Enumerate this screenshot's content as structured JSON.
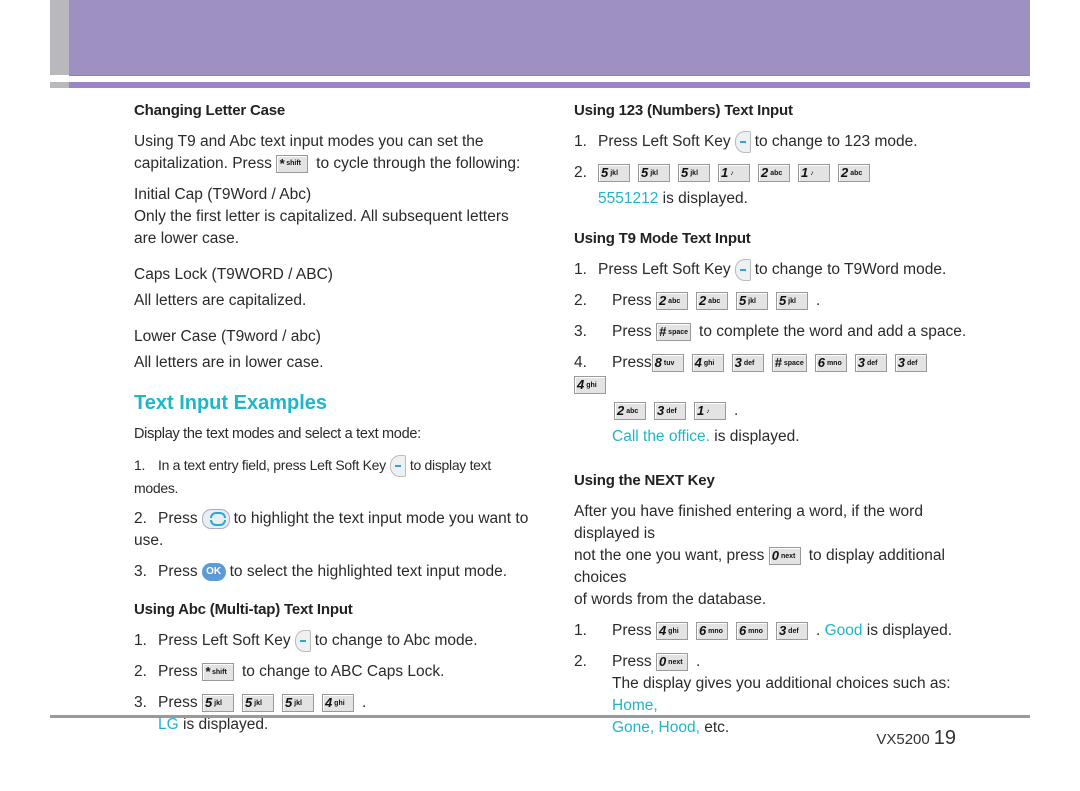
{
  "left": {
    "changing_case": {
      "heading": "Changing Letter Case",
      "intro_1": "Using T9 and Abc text input modes you can set the",
      "intro_2a": "capitalization. Press",
      "intro_2b": "to cycle through the following:",
      "modes": [
        {
          "name": "Initial Cap (T9Word / Abc)",
          "desc_1": "Only the first letter is capitalized. All subsequent letters",
          "desc_2": "are lower case."
        },
        {
          "name": "Caps Lock (T9WORD / ABC)",
          "desc_1": "All letters are capitalized."
        },
        {
          "name": "Lower Case (T9word / abc)",
          "desc_1": "All letters are in lower case."
        }
      ]
    },
    "examples": {
      "title": "Text Input Examples",
      "intro": "Display the text modes and select a text mode:",
      "steps": [
        {
          "n": "1.",
          "a": "In a text entry field, press Left Soft Key",
          "b": "to display text modes."
        },
        {
          "n": "2.",
          "a": "Press",
          "b": "to highlight the text input mode you want to use."
        },
        {
          "n": "3.",
          "a": "Press",
          "b": "to select the highlighted text input mode.",
          "ok": "OK"
        }
      ]
    },
    "abc": {
      "heading": "Using Abc (Multi-tap) Text Input",
      "s1a": "Press Left Soft Key",
      "s1b": "to change to Abc mode.",
      "s2a": "Press",
      "s2b": "to change to ABC Caps Lock.",
      "s3a": "Press",
      "keys": [
        {
          "d": "5",
          "l": "jkl"
        },
        {
          "d": "5",
          "l": "jkl"
        },
        {
          "d": "5",
          "l": "jkl"
        },
        {
          "d": "4",
          "l": "ghi"
        }
      ],
      "result": "LG",
      "result_suffix": "is displayed."
    }
  },
  "right": {
    "numbers": {
      "heading": "Using 123 (Numbers) Text Input",
      "s1a": "Press Left Soft Key",
      "s1b": "to change to 123 mode.",
      "keys": [
        {
          "d": "5",
          "l": "jkl"
        },
        {
          "d": "5",
          "l": "jkl"
        },
        {
          "d": "5",
          "l": "jkl"
        },
        {
          "d": "1",
          "l": "♪"
        },
        {
          "d": "2",
          "l": "abc"
        },
        {
          "d": "1",
          "l": "♪"
        },
        {
          "d": "2",
          "l": "abc"
        }
      ],
      "result": "5551212",
      "result_suffix": "is displayed."
    },
    "t9": {
      "heading": "Using T9 Mode Text Input",
      "s1a": "Press Left Soft Key",
      "s1b": "to change to T9Word  mode.",
      "s2a": "Press",
      "s2keys": [
        {
          "d": "2",
          "l": "abc"
        },
        {
          "d": "2",
          "l": "abc"
        },
        {
          "d": "5",
          "l": "jkl"
        },
        {
          "d": "5",
          "l": "jkl"
        }
      ],
      "s3a": "Press",
      "s3key": {
        "d": "#",
        "l": "space"
      },
      "s3b": "to complete the word and add a space.",
      "s4a": "Press",
      "s4keys": [
        {
          "d": "8",
          "l": "tuv"
        },
        {
          "d": "4",
          "l": "ghi"
        },
        {
          "d": "3",
          "l": "def"
        },
        {
          "d": "#",
          "l": "space"
        },
        {
          "d": "6",
          "l": "mno"
        },
        {
          "d": "3",
          "l": "def"
        },
        {
          "d": "3",
          "l": "def"
        },
        {
          "d": "4",
          "l": "ghi"
        }
      ],
      "s4keys2": [
        {
          "d": "2",
          "l": "abc"
        },
        {
          "d": "3",
          "l": "def"
        },
        {
          "d": "1",
          "l": "♪"
        }
      ],
      "result": "Call the office.",
      "result_suffix": "is displayed."
    },
    "next": {
      "heading": "Using the NEXT Key",
      "p1": "After you have finished entering a word, if the word displayed is",
      "p2a": "not the one you want, press",
      "p2b": "to display additional choices",
      "p3": "of words from the database.",
      "nextkey": {
        "d": "0",
        "l": "next"
      },
      "s1a": "Press",
      "s1keys": [
        {
          "d": "4",
          "l": "ghi"
        },
        {
          "d": "6",
          "l": "mno"
        },
        {
          "d": "6",
          "l": "mno"
        },
        {
          "d": "3",
          "l": "def"
        }
      ],
      "s1result": "Good",
      "s1suffix": "is displayed.",
      "s2a": "Press",
      "s2b": "The display gives you additional choices such as:",
      "s2c": "Home,",
      "s2d": "Gone, Hood,",
      "s2e": "etc."
    }
  },
  "footer": {
    "model": "VX5200",
    "page": "19"
  },
  "star_key": {
    "d": "*",
    "l": "shift"
  }
}
